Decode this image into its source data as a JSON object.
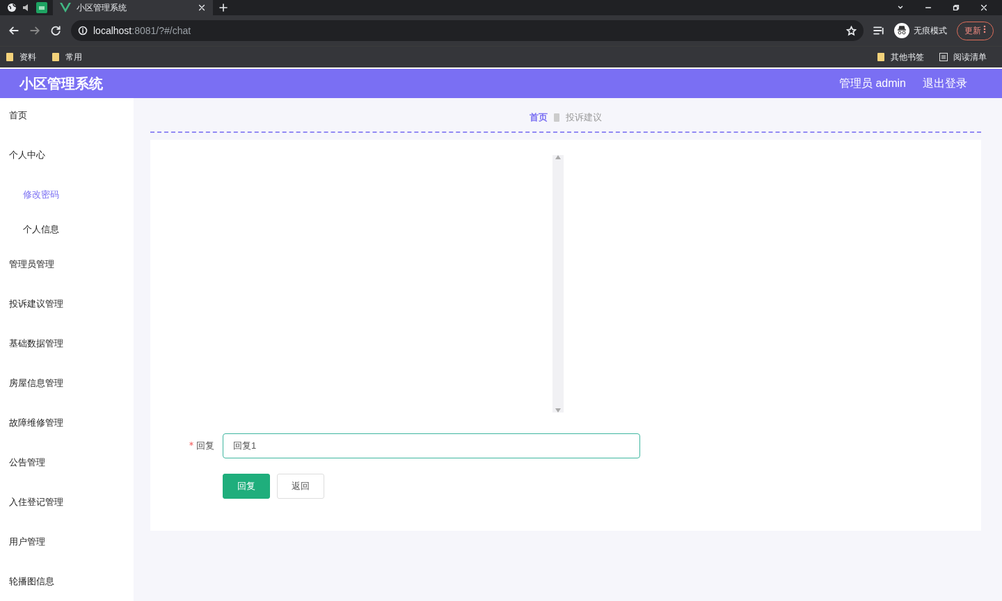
{
  "browser": {
    "tabs": [
      {
        "title": "小区管理系统",
        "selected": true
      }
    ],
    "address": {
      "host": "localhost",
      "path": ":8081/?#/chat"
    },
    "profile": "无痕模式",
    "update": "更新",
    "bookmarks": [
      "资料",
      "常用"
    ],
    "bookmarks_right": [
      "其他书签",
      "阅读清单"
    ]
  },
  "header": {
    "title": "小区管理系统",
    "user": "管理员 admin",
    "logout": "退出登录"
  },
  "sidebar": {
    "items": [
      {
        "label": "首页",
        "selected": false
      },
      {
        "label": "个人中心",
        "selected": false,
        "expanded": true,
        "children": [
          {
            "label": "修改密码",
            "selected": true
          },
          {
            "label": "个人信息",
            "selected": false
          }
        ]
      },
      {
        "label": "管理员管理",
        "selected": false
      },
      {
        "label": "投诉建议管理",
        "selected": false
      },
      {
        "label": "基础数据管理",
        "selected": false
      },
      {
        "label": "房屋信息管理",
        "selected": false
      },
      {
        "label": "故障维修管理",
        "selected": false
      },
      {
        "label": "公告管理",
        "selected": false
      },
      {
        "label": "入住登记管理",
        "selected": false
      },
      {
        "label": "用户管理",
        "selected": false
      },
      {
        "label": "轮播图信息",
        "selected": false
      }
    ]
  },
  "breadcrumb": [
    "首页",
    "投诉建议"
  ],
  "form": {
    "label": "回复",
    "required": true,
    "value": "回复1",
    "buttons": [
      {
        "label": "回复",
        "kind": "primary"
      },
      {
        "label": "返回",
        "kind": "plain"
      }
    ]
  }
}
